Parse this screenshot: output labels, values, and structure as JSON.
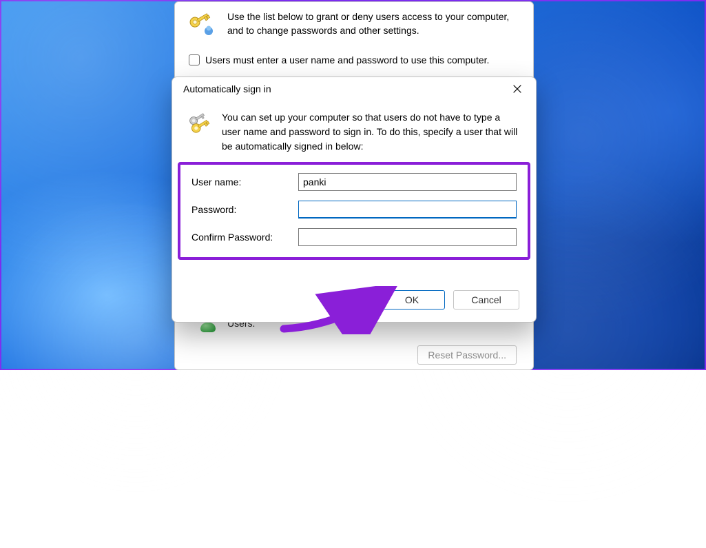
{
  "user_accounts": {
    "description": "Use the list below to grant or deny users access to your computer, and to change passwords and other settings.",
    "checkbox_label": "Users must enter a user name and password to use this computer.",
    "checkbox_checked": false,
    "users_label": "Users.",
    "reset_password_button": "Reset Password..."
  },
  "dialog": {
    "title": "Automatically sign in",
    "info_text": "You can set up your computer so that users do not have to type a user name and password to sign in. To do this, specify a user that will be automatically signed in below:",
    "fields": {
      "username_label": "User name:",
      "username_value": "panki",
      "password_label": "Password:",
      "password_value": "",
      "confirm_label": "Confirm Password:",
      "confirm_value": ""
    },
    "buttons": {
      "ok": "OK",
      "cancel": "Cancel"
    }
  },
  "annotation": {
    "highlight_color": "#8a1fd8"
  }
}
